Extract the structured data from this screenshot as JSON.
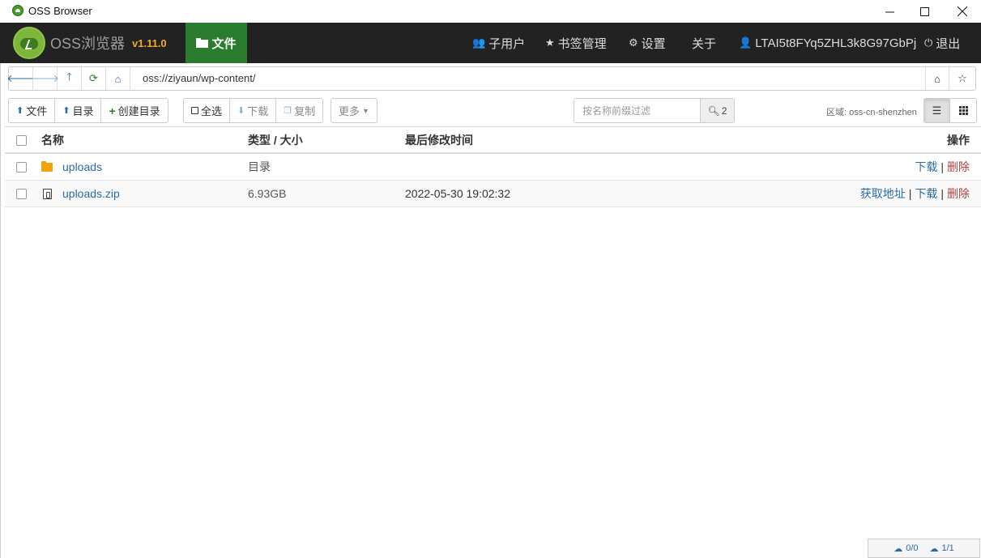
{
  "window": {
    "title": "OSS Browser"
  },
  "navbar": {
    "brand": "OSS浏览器",
    "version": "v1.11.0",
    "files_tab": "文件",
    "items": [
      {
        "label": "子用户",
        "icon": "users-icon"
      },
      {
        "label": "书签管理",
        "icon": "star-icon"
      },
      {
        "label": "设置",
        "icon": "gear-icon"
      },
      {
        "label": "关于",
        "icon": ""
      },
      {
        "label": "LTAI5t8FYq5ZHL3k8G97GbPj",
        "icon": "user-icon"
      },
      {
        "label": "退出",
        "icon": "power-icon"
      }
    ]
  },
  "address": {
    "value": "oss://ziyaun/wp-content/"
  },
  "toolbar": {
    "upload_file": "文件",
    "upload_dir": "目录",
    "create_dir": "创建目录",
    "select_all": "全选",
    "download": "下载",
    "copy": "复制",
    "more": "更多",
    "filter_placeholder": "按名称前缀过滤",
    "filter_count": "2",
    "region": "区域: oss-cn-shenzhen"
  },
  "table": {
    "headers": {
      "name": "名称",
      "type_size": "类型 / 大小",
      "modified": "最后修改时间",
      "actions": "操作"
    },
    "rows": [
      {
        "name": "uploads",
        "type": "目录",
        "modified": "",
        "kind": "folder",
        "actions": [
          "下载",
          "删除"
        ]
      },
      {
        "name": "uploads.zip",
        "type": "6.93GB",
        "modified": "2022-05-30 19:02:32",
        "kind": "file",
        "actions": [
          "获取地址",
          "下载",
          "删除"
        ]
      }
    ]
  },
  "status": {
    "upload": "0/0",
    "download": "1/1"
  },
  "colors": {
    "navbar": "#222222",
    "accent": "#2a7d2e",
    "version": "#f0ad1e",
    "link": "#2a6aa5",
    "danger": "#a94442"
  }
}
